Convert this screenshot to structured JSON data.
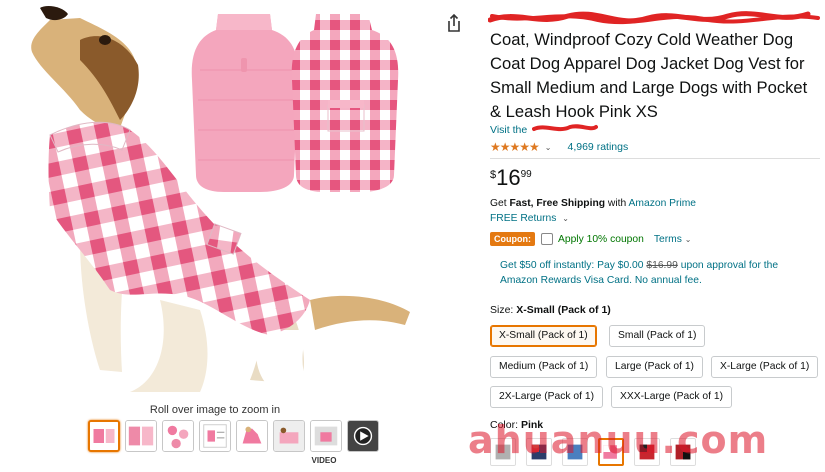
{
  "product": {
    "title": "Coat, Windproof Cozy Cold Weather Dog Coat Dog Apparel Dog Jacket Dog Vest for Small Medium and Large Dogs with Pocket & Leash Hook Pink XS",
    "store_prefix": "Visit the",
    "rating_stars": "★★★★★",
    "ratings_count": "4,969 ratings",
    "price_symbol": "$",
    "price_whole": "16",
    "price_fraction": "99"
  },
  "shipping": {
    "get": "Get",
    "fast_free": "Fast, Free Shipping",
    "with": "with",
    "prime": "Amazon Prime",
    "returns": "FREE Returns"
  },
  "coupon": {
    "badge": "Coupon:",
    "apply": "Apply 10% coupon",
    "terms": "Terms"
  },
  "offer": {
    "line_a": "Get $50 off instantly: Pay $0.00",
    "strike": "$16.99",
    "line_b": "upon approval for the Amazon Rewards Visa Card. No annual fee."
  },
  "size": {
    "label": "Size:",
    "selected": "X-Small (Pack of 1)",
    "options": [
      "X-Small (Pack of 1)",
      "Small (Pack of 1)",
      "Medium (Pack of 1)",
      "Large (Pack of 1)",
      "X-Large (Pack of 1)",
      "2X-Large (Pack of 1)",
      "XXX-Large (Pack of 1)"
    ]
  },
  "color": {
    "label": "Color:",
    "selected": "Pink"
  },
  "gallery": {
    "zoom_hint": "Roll over image to zoom in",
    "video_label": "VIDEO"
  },
  "watermark": "ahuanuu.com",
  "colors": {
    "link": "#007185",
    "accent": "#e77600",
    "coupon_badge": "#e47911",
    "coupon_text": "#007600",
    "star": "#de7921",
    "pink": "#f07aa0"
  }
}
